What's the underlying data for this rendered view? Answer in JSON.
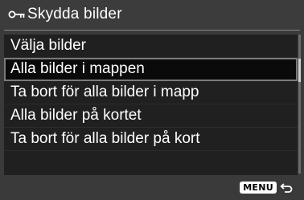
{
  "header": {
    "title": "Skydda bilder",
    "icon": "key-icon"
  },
  "menu": {
    "items": [
      {
        "label": "Välja bilder"
      },
      {
        "label": "Alla bilder i mappen",
        "selected": true
      },
      {
        "label": "Ta bort för alla bilder i mapp"
      },
      {
        "label": "Alla bilder på kortet"
      },
      {
        "label": "Ta bort för alla bilder på kort"
      }
    ]
  },
  "footer": {
    "menu_button_label": "MENU",
    "back_icon": "return-arrow-icon"
  }
}
